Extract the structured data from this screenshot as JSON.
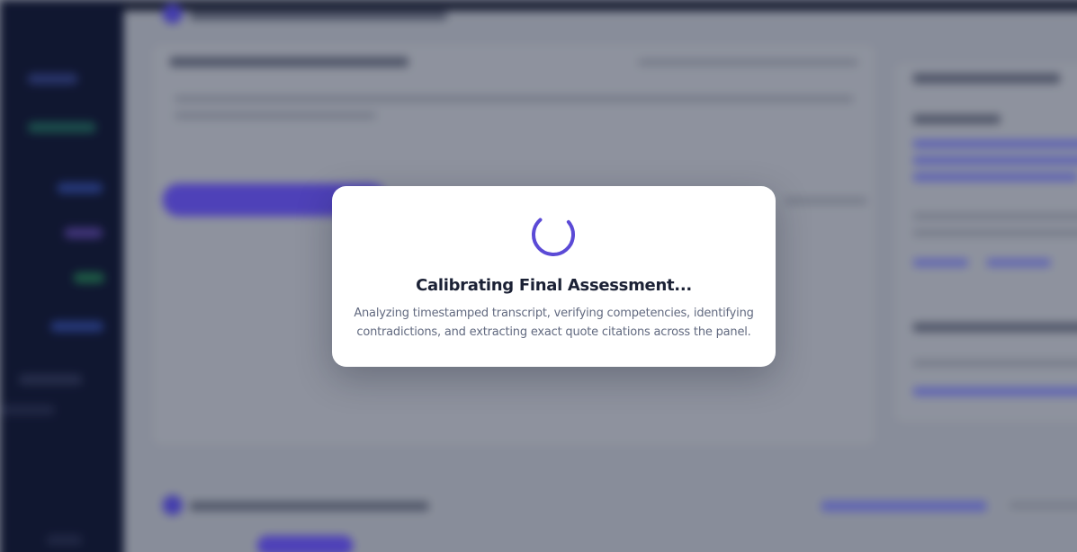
{
  "modal": {
    "title": "Calibrating Final Assessment...",
    "description": "Analyzing timestamped transcript, verifying competencies, identifying contradictions, and extracting exact quote citations across the panel."
  },
  "colors": {
    "accent": "#5b4ad6",
    "sidebar_bg": "#0f1630",
    "modal_bg": "#ffffff",
    "title_text": "#1b2135",
    "body_text": "#626a80"
  },
  "icons": {
    "spinner": "loading-spinner-icon"
  }
}
